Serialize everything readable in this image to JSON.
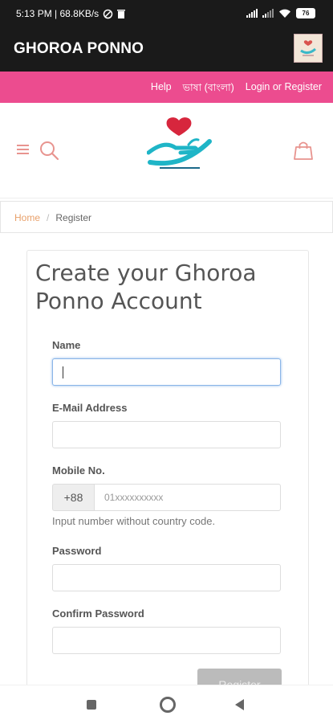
{
  "status_bar": {
    "time_speed": "5:13 PM | 68.8KB/s",
    "battery": "76"
  },
  "app_bar": {
    "title": "GHOROA PONNO"
  },
  "top_links": [
    "Help",
    "ভাষা (বাংলা)",
    "Login or Register"
  ],
  "breadcrumb": {
    "home": "Home",
    "separator": "/",
    "current": "Register"
  },
  "form": {
    "heading": "Create your Ghoroa Ponno Account",
    "name_label": "Name",
    "email_label": "E-Mail Address",
    "mobile_label": "Mobile No.",
    "country_code": "+88",
    "mobile_placeholder": "01xxxxxxxxxx",
    "mobile_hint": "Input number without country code.",
    "password_label": "Password",
    "confirm_label": "Confirm Password",
    "register_label": "Register"
  },
  "colors": {
    "pink": "#ec4c8f",
    "dark": "#1a1a1a",
    "accent": "#e8948f"
  }
}
